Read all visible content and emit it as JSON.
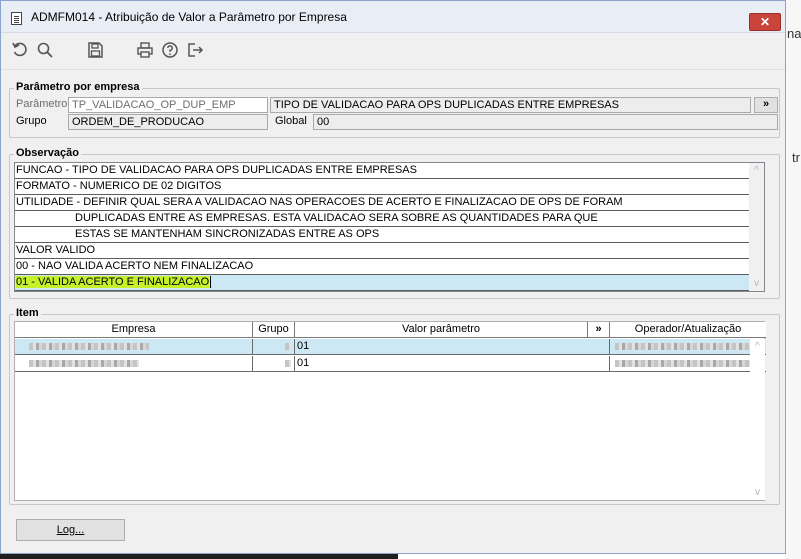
{
  "window": {
    "title": "ADMFM014 - Atribuição de Valor a Parâmetro por Empresa",
    "close_label": "✕"
  },
  "background": {
    "fragment_1": "na",
    "fragment_2": "tr"
  },
  "toolbar": {
    "undo_icon": "undo-icon",
    "search_icon": "search-icon",
    "save_icon": "save-icon",
    "print_icon": "print-icon",
    "help_icon": "help-icon",
    "exit_icon": "exit-icon"
  },
  "parametro_section": {
    "title": "Parâmetro por empresa",
    "parametro_label": "Parâmetro",
    "parametro_value": "TP_VALIDACAO_OP_DUP_EMP",
    "parametro_description": "TIPO DE VALIDACAO PARA OPS DUPLICADAS ENTRE EMPRESAS",
    "expand_label": "»",
    "grupo_label": "Grupo",
    "grupo_value": "ORDEM_DE_PRODUCAO",
    "global_label": "Global",
    "global_value": "00"
  },
  "observacao_section": {
    "title": "Observação",
    "lines": [
      "FUNCAO - TIPO DE VALIDACAO PARA OPS DUPLICADAS ENTRE EMPRESAS",
      "FORMATO - NUMERICO DE 02 DIGITOS",
      "UTILIDADE - DEFINIR QUAL SERA A VALIDACAO NAS OPERACOES DE ACERTO E FINALIZACAO DE OPS DE FORAM",
      "DUPLICADAS ENTRE AS EMPRESAS. ESTA VALIDACAO SERA SOBRE AS QUANTIDADES PARA QUE",
      "ESTAS SE MANTENHAM SINCRONIZADAS ENTRE AS OPS",
      "VALOR VALIDO",
      "00 - NAO VALIDA ACERTO NEM FINALIZACAO",
      "01 - VALIDA ACERTO E FINALIZACAO"
    ],
    "scroll_up": "^",
    "scroll_down": "v"
  },
  "item_section": {
    "title": "Item",
    "columns": {
      "empresa": "Empresa",
      "grupo": "Grupo",
      "valor": "Valor parâmetro",
      "expand": "»",
      "operador": "Operador/Atualização"
    },
    "rows": [
      {
        "valor": "01"
      },
      {
        "valor": "01"
      }
    ],
    "scroll_up": "^",
    "scroll_down": "v"
  },
  "footer": {
    "log_button": "Log..."
  },
  "colors": {
    "selection": "#cce8f4",
    "highlight": "#c6f02a",
    "close_red": "#c9443a"
  }
}
